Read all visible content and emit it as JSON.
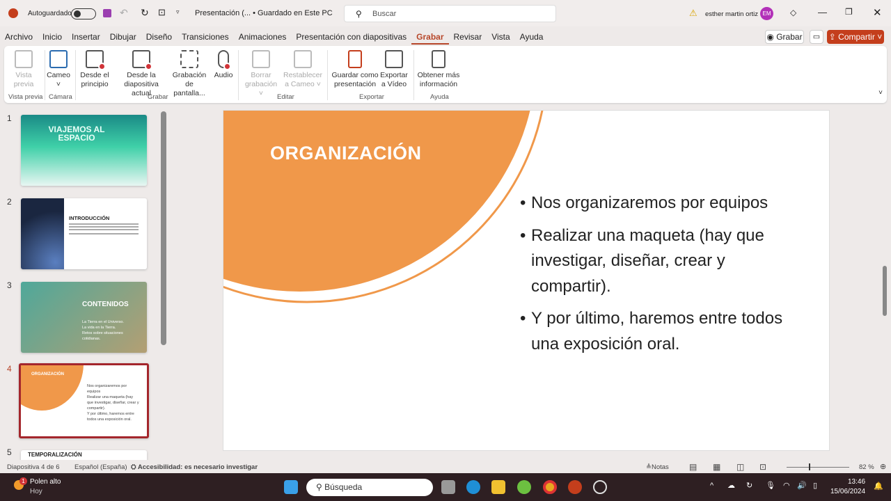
{
  "titlebar": {
    "autosave_label": "Autoguardado",
    "doc_title": "Presentación (... • Guardado en Este PC",
    "search_placeholder": "Buscar",
    "user_name": "esther martin ortiz",
    "user_initials": "EM"
  },
  "menu": {
    "items": [
      "Archivo",
      "Inicio",
      "Insertar",
      "Dibujar",
      "Diseño",
      "Transiciones",
      "Animaciones",
      "Presentación con diapositivas",
      "Grabar",
      "Revisar",
      "Vista",
      "Ayuda"
    ],
    "active": "Grabar",
    "record_button": "Grabar",
    "share_button": "Compartir"
  },
  "ribbon": {
    "buttons": [
      {
        "label": "Vista previa",
        "disabled": true
      },
      {
        "label": "Cameo ˅"
      },
      {
        "label": "Desde el principio"
      },
      {
        "label": "Desde la diapositiva actual"
      },
      {
        "label": "Grabación de pantalla..."
      },
      {
        "label": "Audio"
      },
      {
        "label": "Borrar grabación ˅",
        "disabled": true
      },
      {
        "label": "Restablecer a Cameo ˅",
        "disabled": true
      },
      {
        "label": "Guardar como presentación"
      },
      {
        "label": "Exportar a Vídeo"
      },
      {
        "label": "Obtener más información"
      }
    ],
    "groups": [
      "Vista previa",
      "Cámara",
      "Grabar",
      "Editar",
      "Exportar",
      "Ayuda"
    ]
  },
  "thumbnails": [
    {
      "num": "1",
      "title": "VIAJEMOS AL ESPACIO"
    },
    {
      "num": "2",
      "title": "INTRODUCCIÓN"
    },
    {
      "num": "3",
      "title": "CONTENIDOS",
      "bullets": [
        "La Tierra en el Universo.",
        "La vida en la Tierra.",
        "Retos sobre situaciones cotidianas."
      ]
    },
    {
      "num": "4",
      "title": "ORGANIZACIÓN"
    },
    {
      "num": "5",
      "title": "TEMPORALIZACIÓN"
    }
  ],
  "slide": {
    "title": "ORGANIZACIÓN",
    "bullets": [
      "Nos organizaremos por equipos",
      "Realizar una maqueta (hay que investigar, diseñar, crear y compartir).",
      "Y por último, haremos entre todos una exposición oral."
    ],
    "accent": "#f0984a"
  },
  "status": {
    "slide_info": "Diapositiva 4 de 6",
    "language": "Español (España)",
    "accessibility": "Accesibilidad: es necesario investigar",
    "notes": "Notas",
    "zoom": "82 %"
  },
  "taskbar": {
    "weather_title": "Polen alto",
    "weather_sub": "Hoy",
    "weather_badge": "1",
    "search": "Búsqueda",
    "time": "13:46",
    "date": "15/06/2024"
  }
}
